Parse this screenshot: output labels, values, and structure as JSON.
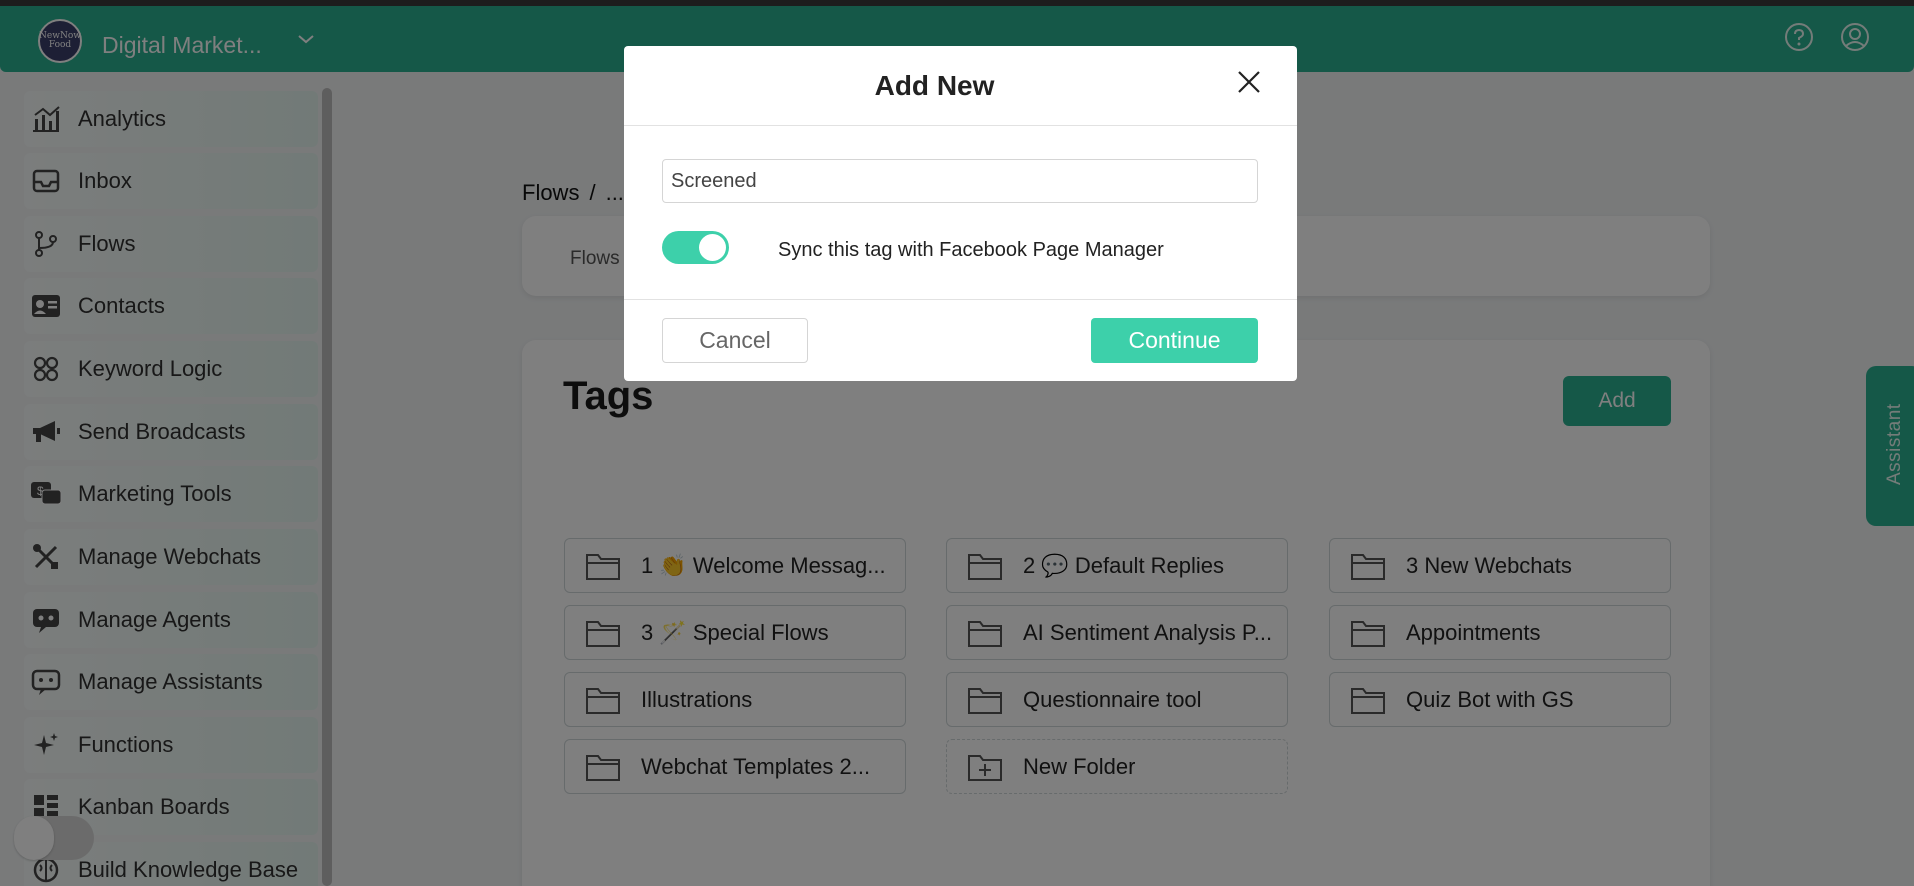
{
  "app": {
    "workspace_name": "Digital Market...",
    "logo_text": "NewNow Food"
  },
  "sidebar": {
    "items": [
      {
        "label": "Analytics",
        "icon": "analytics-icon"
      },
      {
        "label": "Inbox",
        "icon": "inbox-icon"
      },
      {
        "label": "Flows",
        "icon": "flows-icon"
      },
      {
        "label": "Contacts",
        "icon": "contacts-icon"
      },
      {
        "label": "Keyword Logic",
        "icon": "keyword-logic-icon"
      },
      {
        "label": "Send Broadcasts",
        "icon": "megaphone-icon"
      },
      {
        "label": "Marketing Tools",
        "icon": "marketing-tools-icon"
      },
      {
        "label": "Manage Webchats",
        "icon": "tools-icon"
      },
      {
        "label": "Manage Agents",
        "icon": "agent-icon"
      },
      {
        "label": "Manage Assistants",
        "icon": "assistant-icon"
      },
      {
        "label": "Functions",
        "icon": "sparkle-icon"
      },
      {
        "label": "Kanban Boards",
        "icon": "kanban-icon"
      },
      {
        "label": "Build Knowledge Base",
        "icon": "brain-icon"
      }
    ]
  },
  "breadcrumb": {
    "root": "Flows",
    "separator": "/",
    "current": "..."
  },
  "crumb_card": {
    "text": "Flows"
  },
  "tags_section": {
    "title": "Tags",
    "add_label": "Add",
    "folders": [
      {
        "label": "1 👏 Welcome Messag..."
      },
      {
        "label": "2 💬 Default Replies"
      },
      {
        "label": "3 New Webchats"
      },
      {
        "label": "3 🪄 Special Flows"
      },
      {
        "label": "AI Sentiment Analysis P..."
      },
      {
        "label": "Appointments"
      },
      {
        "label": "Illustrations"
      },
      {
        "label": "Questionnaire tool"
      },
      {
        "label": "Quiz Bot with GS"
      },
      {
        "label": "Webchat Templates 2..."
      },
      {
        "label": "New Folder"
      }
    ]
  },
  "assistant_tab": {
    "label": "Assistant"
  },
  "modal": {
    "title": "Add New",
    "input_value": "Screened",
    "toggle_on": true,
    "toggle_label": "Sync this tag with Facebook Page Manager",
    "cancel_label": "Cancel",
    "continue_label": "Continue"
  },
  "colors": {
    "brand": "#2ab091",
    "accent": "#3dd0aa"
  }
}
